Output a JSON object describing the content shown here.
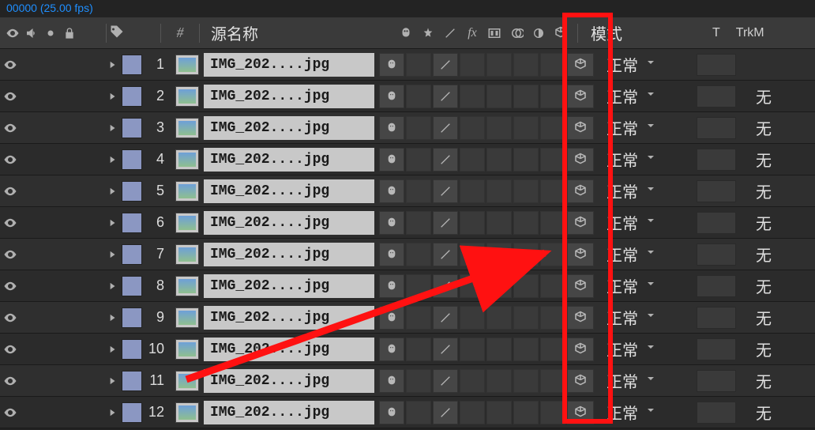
{
  "top_status": "00000 (25.00 fps)",
  "header": {
    "source_name": "源名称",
    "mode": "模式",
    "T": "T",
    "trk": "TrkM"
  },
  "mode_default": "正常",
  "none_label": "无",
  "layers": [
    {
      "index": 1,
      "name": "IMG_202....jpg"
    },
    {
      "index": 2,
      "name": "IMG_202....jpg"
    },
    {
      "index": 3,
      "name": "IMG_202....jpg"
    },
    {
      "index": 4,
      "name": "IMG_202....jpg"
    },
    {
      "index": 5,
      "name": "IMG_202....jpg"
    },
    {
      "index": 6,
      "name": "IMG_202....jpg"
    },
    {
      "index": 7,
      "name": "IMG_202....jpg"
    },
    {
      "index": 8,
      "name": "IMG_202....jpg"
    },
    {
      "index": 9,
      "name": "IMG_202....jpg"
    },
    {
      "index": 10,
      "name": "IMG_202....jpg"
    },
    {
      "index": 11,
      "name": "IMG_202....jpg"
    },
    {
      "index": 12,
      "name": "IMG_202....jpg"
    }
  ]
}
